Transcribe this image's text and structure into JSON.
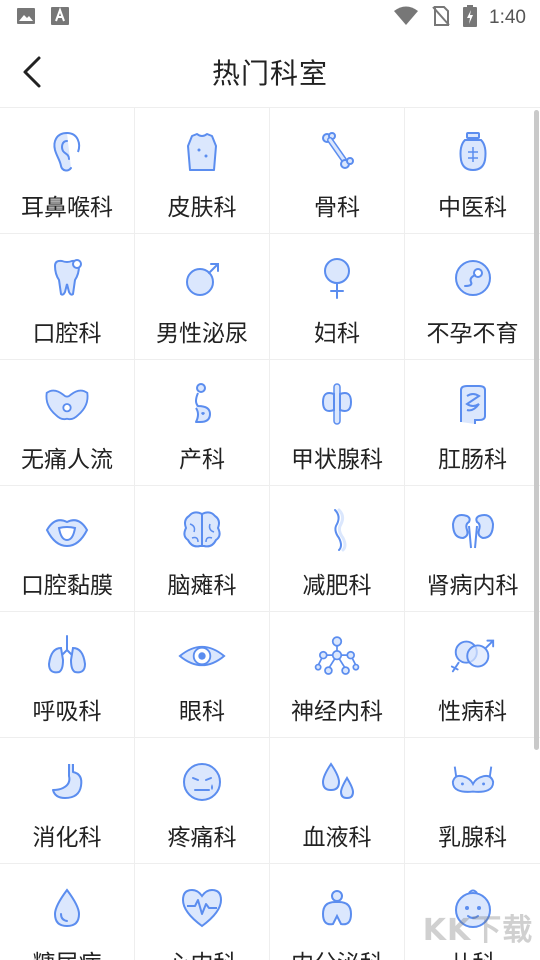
{
  "status_bar": {
    "time": "1:40",
    "icons": [
      "image-icon",
      "text-a-icon",
      "wifi-icon",
      "no-sim-icon",
      "battery-charging-icon"
    ]
  },
  "header": {
    "title": "热门科室",
    "back_icon": "chevron-left-icon"
  },
  "colors": {
    "icon_stroke": "#5b8def",
    "icon_fill": "#dbe7fd",
    "divider": "#eeeeee",
    "text": "#222222"
  },
  "departments": [
    {
      "label": "耳鼻喉科",
      "icon": "ear-icon"
    },
    {
      "label": "皮肤科",
      "icon": "skin-torso-icon"
    },
    {
      "label": "骨科",
      "icon": "bone-icon"
    },
    {
      "label": "中医科",
      "icon": "medicine-jar-icon"
    },
    {
      "label": "口腔科",
      "icon": "tooth-icon"
    },
    {
      "label": "男性泌尿",
      "icon": "male-symbol-icon"
    },
    {
      "label": "妇科",
      "icon": "female-symbol-icon"
    },
    {
      "label": "不孕不育",
      "icon": "sperm-egg-icon"
    },
    {
      "label": "无痛人流",
      "icon": "pelvis-icon"
    },
    {
      "label": "产科",
      "icon": "pregnant-icon"
    },
    {
      "label": "甲状腺科",
      "icon": "thyroid-icon"
    },
    {
      "label": "肛肠科",
      "icon": "intestine-icon"
    },
    {
      "label": "口腔黏膜",
      "icon": "mouth-icon"
    },
    {
      "label": "脑瘫科",
      "icon": "brain-icon"
    },
    {
      "label": "减肥科",
      "icon": "slim-body-icon"
    },
    {
      "label": "肾病内科",
      "icon": "kidney-icon"
    },
    {
      "label": "呼吸科",
      "icon": "lungs-icon"
    },
    {
      "label": "眼科",
      "icon": "eye-icon"
    },
    {
      "label": "神经内科",
      "icon": "neuron-network-icon"
    },
    {
      "label": "性病科",
      "icon": "gender-symbols-icon"
    },
    {
      "label": "消化科",
      "icon": "stomach-icon"
    },
    {
      "label": "疼痛科",
      "icon": "pain-face-icon"
    },
    {
      "label": "血液科",
      "icon": "blood-drops-icon"
    },
    {
      "label": "乳腺科",
      "icon": "bra-icon"
    },
    {
      "label": "糖尿病",
      "icon": "drop-icon"
    },
    {
      "label": "心内科",
      "icon": "heart-pulse-icon"
    },
    {
      "label": "内分泌科",
      "icon": "endocrine-icon"
    },
    {
      "label": "儿科",
      "icon": "baby-face-icon"
    }
  ],
  "watermark": "KK下载"
}
